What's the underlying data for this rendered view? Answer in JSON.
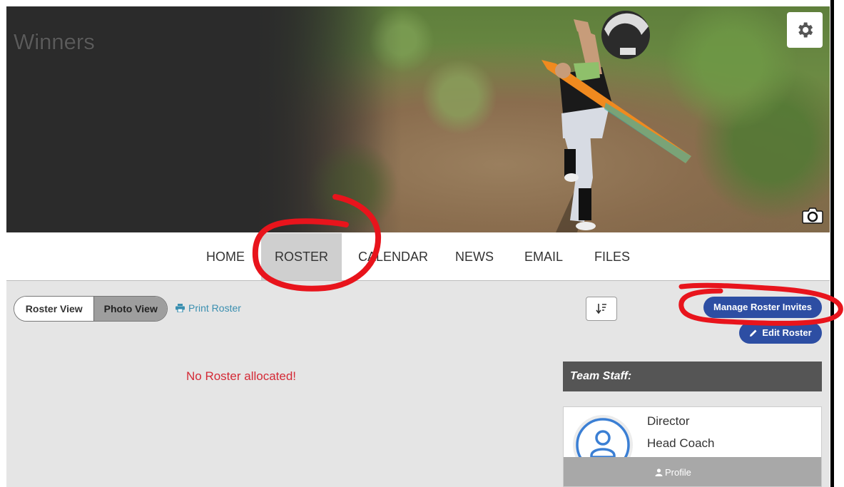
{
  "team": {
    "name": "Winners"
  },
  "banner": {
    "settings_icon": "gear-icon",
    "photo_icon": "camera-icon"
  },
  "nav": {
    "tabs": [
      {
        "label": "HOME",
        "active": false
      },
      {
        "label": "ROSTER",
        "active": true
      },
      {
        "label": "CALENDAR",
        "active": false
      },
      {
        "label": "NEWS",
        "active": false
      },
      {
        "label": "EMAIL",
        "active": false
      },
      {
        "label": "FILES",
        "active": false
      }
    ]
  },
  "toolbar": {
    "roster_view_label": "Roster View",
    "photo_view_label": "Photo View",
    "selected_view": "Photo View",
    "print_label": "Print Roster",
    "print_icon": "print-icon",
    "sort_icon": "sort-icon",
    "manage_invites_label": "Manage Roster Invites",
    "edit_roster_label": "Edit Roster",
    "edit_icon": "pencil-icon"
  },
  "roster": {
    "empty_message": "No Roster allocated!"
  },
  "staff": {
    "header": "Team Staff:",
    "members": [
      {
        "roles": [
          "Director",
          "Head Coach"
        ],
        "profile_label": "Profile",
        "avatar_icon": "user-avatar-icon"
      }
    ]
  },
  "colors": {
    "primary_button": "#2d4ea3",
    "error_text": "#d42a36",
    "link": "#3a8fb0",
    "annotation": "#e8141c"
  }
}
